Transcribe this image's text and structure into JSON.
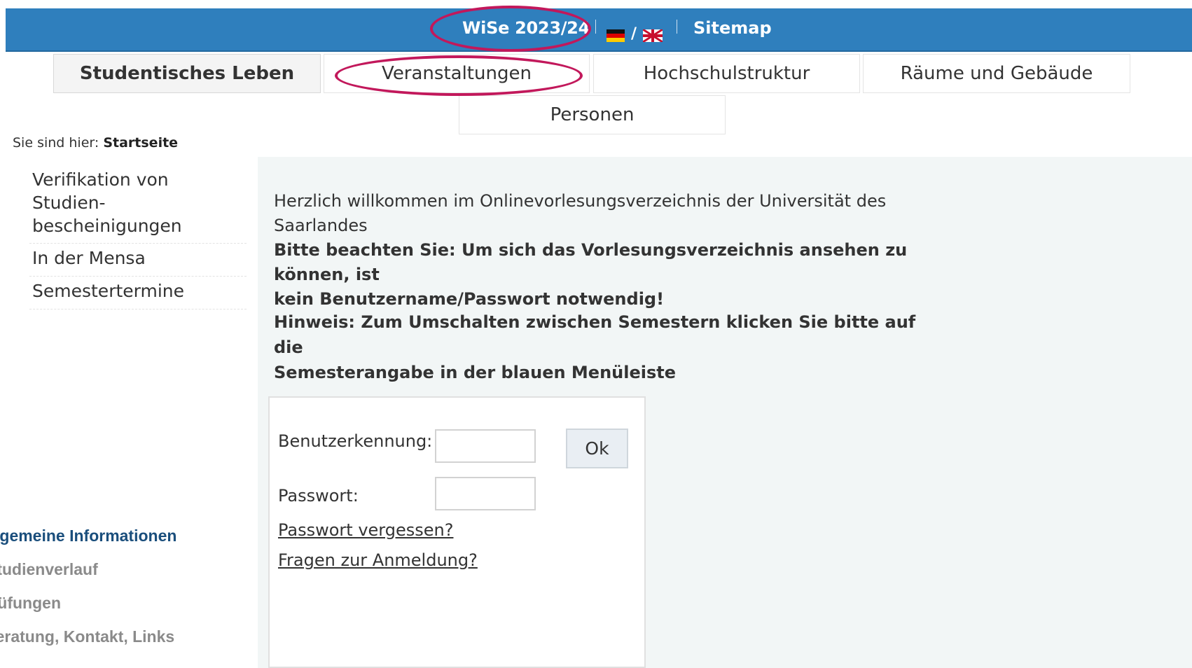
{
  "topbar": {
    "semester": "WiSe 2023/24",
    "flag_separator": "/",
    "sitemap": "Sitemap",
    "colors": {
      "bar": "#2f7fbd",
      "annotation": "#c2185b"
    }
  },
  "tabs": [
    {
      "label": "Studentisches Leben",
      "active": true
    },
    {
      "label": "Veranstaltungen",
      "active": false
    },
    {
      "label": "Hochschulstruktur",
      "active": false
    },
    {
      "label": "Räume und Gebäude",
      "active": false
    },
    {
      "label": "Personen",
      "active": false
    }
  ],
  "breadcrumb": {
    "prefix": "Sie sind hier:",
    "current": "Startseite"
  },
  "leftnav": {
    "items": [
      {
        "line1": "Verifikation von Studien-",
        "line2": "bescheinigungen"
      },
      {
        "line1": "In der Mensa"
      },
      {
        "line1": "Semestertermine"
      }
    ]
  },
  "main": {
    "welcome_line1": "Herzlich willkommen im Onlinevorlesungsverzeichnis der Universität des",
    "welcome_line2": "Saarlandes",
    "notice_line1": "Bitte beachten Sie: Um sich das Vorlesungsverzeichnis ansehen zu können, ist",
    "notice_line2": "kein Benutzername/Passwort notwendig!",
    "hint_line1": "Hinweis: Zum Umschalten zwischen Semestern klicken Sie bitte auf die",
    "hint_line2": "Semesterangabe in der blauen Menüleiste"
  },
  "login": {
    "username_label": "Benutzerkennung:",
    "password_label": "Passwort:",
    "username_value": "",
    "password_value": "",
    "ok_button": "Ok",
    "forgot_link": "Passwort vergessen?",
    "questions_link": "Fragen zur Anmeldung?"
  },
  "bottomnav": {
    "items": [
      {
        "label": "Allgemeine Informationen",
        "kind": "heading"
      },
      {
        "label": "Studienverlauf",
        "kind": "sub"
      },
      {
        "label": "Prüfungen",
        "kind": "sub"
      },
      {
        "label": "Beratung, Kontakt, Links",
        "kind": "sub"
      }
    ]
  }
}
